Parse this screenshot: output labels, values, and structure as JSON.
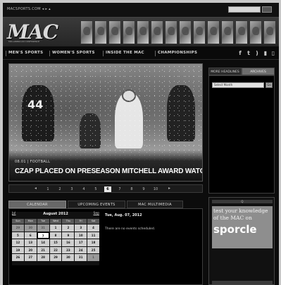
{
  "topbar": {
    "tiny_text": "MACSPORTS.COM  ◂ ▸ ▴"
  },
  "banner": {
    "logo_text": "MAC",
    "logo_sub": "MID-AMERICAN CONFERENCE",
    "helmet_count": 14
  },
  "nav": {
    "items": [
      "MEN'S SPORTS",
      "WOMEN'S SPORTS",
      "INSIDE THE MAC",
      "CHAMPIONSHIPS"
    ],
    "social": [
      "f",
      "t",
      "rss",
      "chart",
      "mobile"
    ]
  },
  "hero": {
    "meta": "08.01 | FOOTBALL",
    "headline": "CZAP PLACED ON PRESEASON MITCHELL AWARD WATCH LIST",
    "player_number": "44"
  },
  "pager": {
    "pages": [
      "1",
      "2",
      "3",
      "4",
      "5",
      "6",
      "7",
      "8",
      "9",
      "10"
    ],
    "active_page": "6",
    "prev": "◂",
    "next": "▸"
  },
  "right_tabs": [
    "MORE HEADLINES",
    "ARCHIVES"
  ],
  "right_panel": {
    "select_value": "Select Month",
    "go_label": "Go"
  },
  "bottom_tabs": [
    "CALENDAR",
    "UPCOMING EVENTS",
    "MAC MULTIMEDIA"
  ],
  "calendar": {
    "prev": "Jul",
    "next": "Sep",
    "title": "August 2012",
    "dow": [
      "Sun",
      "Mon",
      "Tue",
      "Wed",
      "Thu",
      "Fri",
      "Sat"
    ],
    "weeks": [
      [
        "29",
        "30",
        "31",
        "1",
        "2",
        "3",
        "4"
      ],
      [
        "5",
        "6",
        "7",
        "8",
        "9",
        "10",
        "11"
      ],
      [
        "12",
        "13",
        "14",
        "15",
        "16",
        "17",
        "18"
      ],
      [
        "19",
        "20",
        "21",
        "22",
        "23",
        "24",
        "25"
      ],
      [
        "26",
        "27",
        "28",
        "29",
        "30",
        "31",
        "1"
      ]
    ],
    "today": "7"
  },
  "events": {
    "date": "Tue, Aug. 07, 2012",
    "none": "There are no events scheduled."
  },
  "ad": {
    "top": "Q",
    "line1": "test your knowledge",
    "line2": "of the MAC on",
    "line3": "sporcle"
  }
}
